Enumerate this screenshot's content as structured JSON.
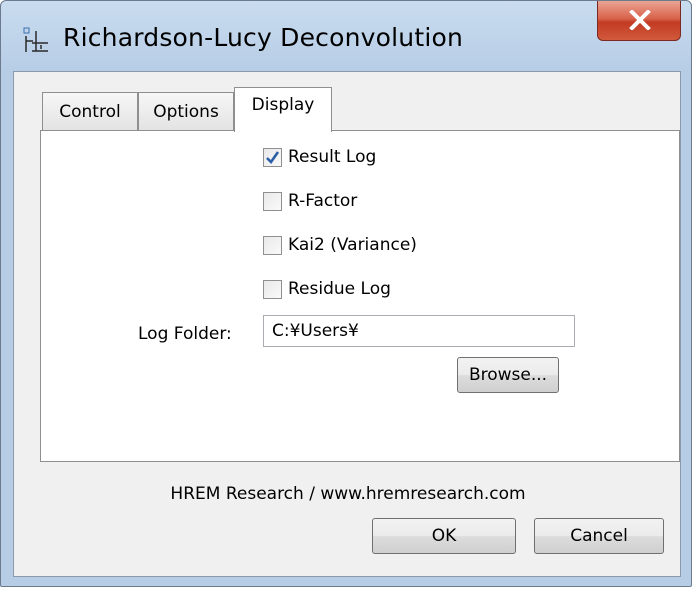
{
  "window": {
    "title": "Richardson-Lucy Deconvolution"
  },
  "tabs": [
    {
      "label": "Control",
      "selected": false
    },
    {
      "label": "Options",
      "selected": false
    },
    {
      "label": "Display",
      "selected": true
    }
  ],
  "display": {
    "checkboxes": [
      {
        "label": "Result Log",
        "checked": true
      },
      {
        "label": "R-Factor",
        "checked": false
      },
      {
        "label": "Kai2 (Variance)",
        "checked": false
      },
      {
        "label": "Residue Log",
        "checked": false
      }
    ],
    "log_folder": {
      "label": "Log Folder:",
      "value": "C:¥Users¥"
    },
    "browse_label": "Browse..."
  },
  "footer": {
    "credit": "HREM Research / www.hremresearch.com",
    "ok_label": "OK",
    "cancel_label": "Cancel"
  },
  "colors": {
    "titlebar": "#b7cde6",
    "close": "#c23b22",
    "check": "#2b5fa8"
  },
  "icons": {
    "app": "deconvolution-app-icon",
    "close": "close-icon",
    "check": "checkmark-icon"
  }
}
